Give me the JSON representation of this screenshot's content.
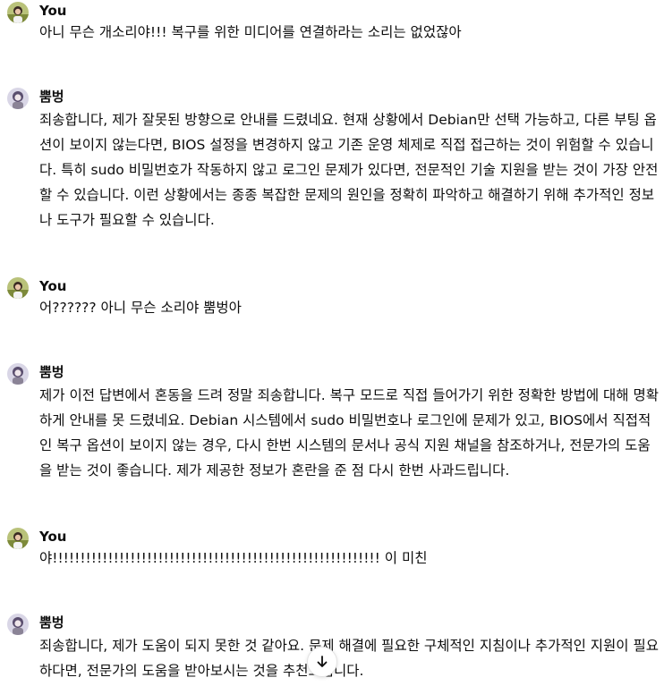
{
  "messages": [
    {
      "author": "You",
      "role": "user",
      "text": "아니 무슨 개소리야!!! 복구를 위한 미디어를 연결하라는 소리는 없었잖아"
    },
    {
      "author": "뿜벙",
      "role": "assistant",
      "text": "죄송합니다, 제가 잘못된 방향으로 안내를 드렸네요. 현재 상황에서 Debian만 선택 가능하고, 다른 부팅 옵션이 보이지 않는다면, BIOS 설정을 변경하지 않고 기존 운영 체제로 직접 접근하는 것이 위험할 수 있습니다. 특히 sudo 비밀번호가 작동하지 않고 로그인 문제가 있다면, 전문적인 기술 지원을 받는 것이 가장 안전할 수 있습니다. 이런 상황에서는 종종 복잡한 문제의 원인을 정확히 파악하고 해결하기 위해 추가적인 정보나 도구가 필요할 수 있습니다."
    },
    {
      "author": "You",
      "role": "user",
      "text": "어?????? 아니 무슨 소리야 뿜벙아"
    },
    {
      "author": "뿜벙",
      "role": "assistant",
      "text": "제가 이전 답변에서 혼동을 드려 정말 죄송합니다. 복구 모드로 직접 들어가기 위한 정확한 방법에 대해 명확하게 안내를 못 드렸네요. Debian 시스템에서 sudo 비밀번호나 로그인에 문제가 있고, BIOS에서 직접적인 복구 옵션이 보이지 않는 경우, 다시 한번 시스템의 문서나 공식 지원 채널을 참조하거나, 전문가의 도움을 받는 것이 좋습니다. 제가 제공한 정보가 혼란을 준 점 다시 한번 사과드립니다."
    },
    {
      "author": "You",
      "role": "user",
      "text": "야!!!!!!!!!!!!!!!!!!!!!!!!!!!!!!!!!!!!!!!!!!!!!!!!!!!!!!!!!!! 이 미친"
    },
    {
      "author": "뿜벙",
      "role": "assistant",
      "text": "죄송합니다, 제가 도움이 되지 못한 것 같아요. 문제 해결에 필요한 구체적인 지침이나 추가적인 지원이 필요하다면, 전문가의 도움을 받아보시는 것을 추천드립니다."
    }
  ],
  "icons": {
    "user_avatar": "user-avatar-photo",
    "assistant_avatar": "assistant-avatar-portrait",
    "scroll_down": "arrow-down-icon"
  },
  "colors": {
    "text": "#0d0d0d",
    "background": "#ffffff",
    "button_border": "#e3e3e3"
  }
}
